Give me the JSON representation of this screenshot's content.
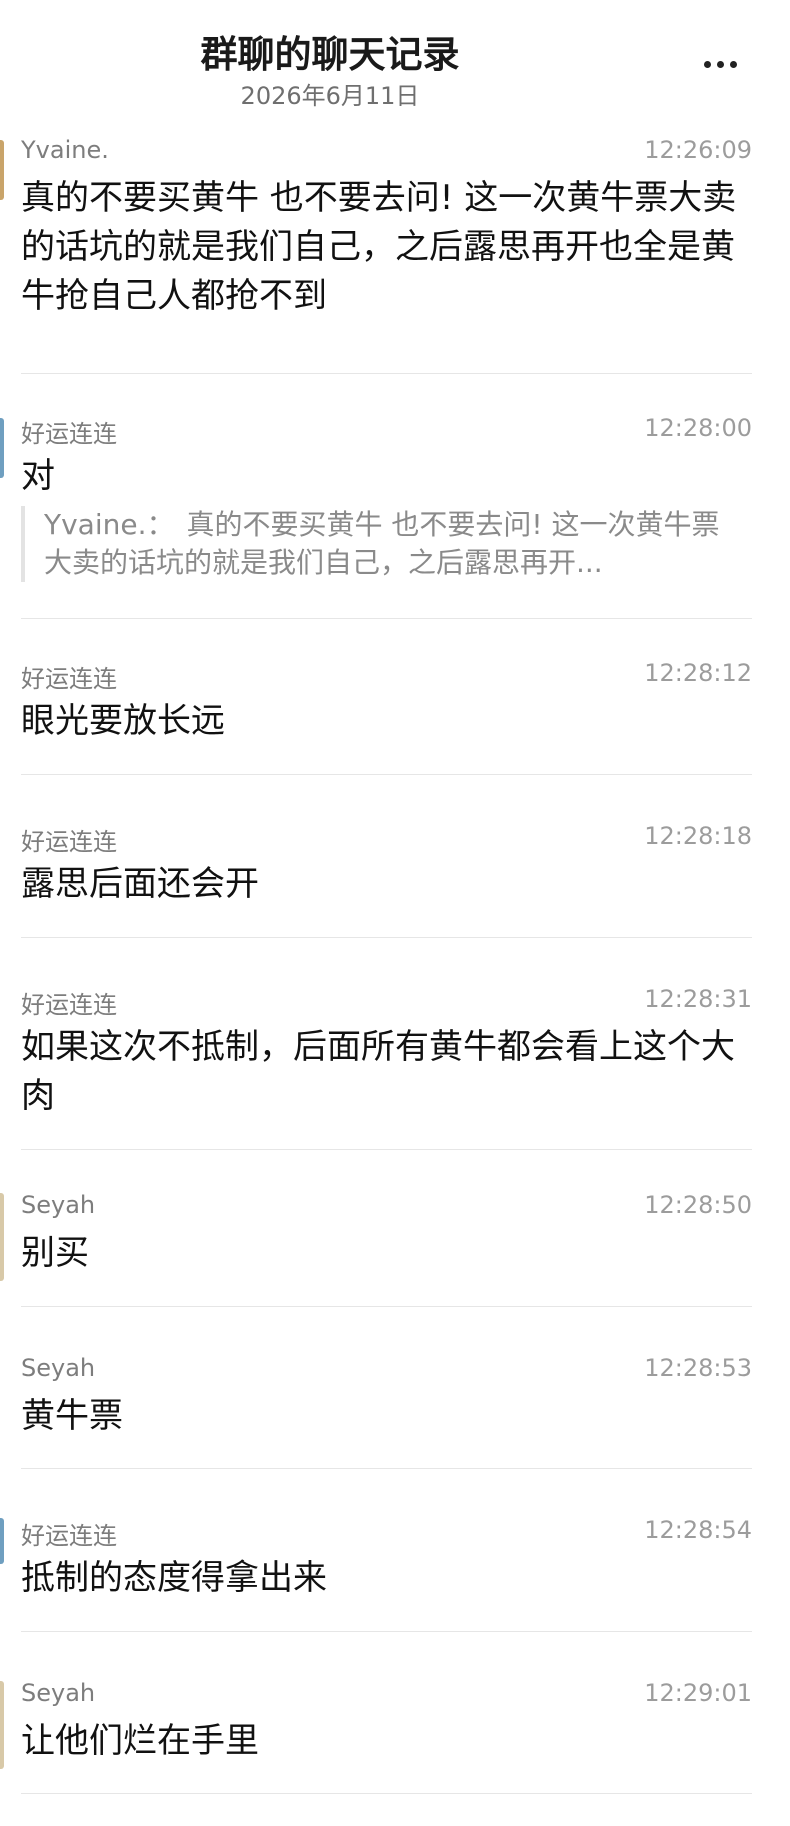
{
  "header": {
    "title": "群聊的聊天记录",
    "date": "2026年6月11日"
  },
  "messages": [
    {
      "sender": "Yvaine.",
      "time": "12:26:09",
      "text": "真的不要买黄牛 也不要去问! 这一次黄牛票大卖的话坑的就是我们自己，之后露思再开也全是黄牛抢自己人都抢不到"
    },
    {
      "sender": "好运连连",
      "time": "12:28:00",
      "text": "对",
      "quote": {
        "sender": "Yvaine.：",
        "text": "真的不要买黄牛 也不要去问! 这一次黄牛票大卖的话坑的就是我们自己，之后露思再开..."
      }
    },
    {
      "sender": "好运连连",
      "time": "12:28:12",
      "text": "眼光要放长远"
    },
    {
      "sender": "好运连连",
      "time": "12:28:18",
      "text": "露思后面还会开"
    },
    {
      "sender": "好运连连",
      "time": "12:28:31",
      "text": "如果这次不抵制，后面所有黄牛都会看上这个大肉"
    },
    {
      "sender": "Seyah",
      "time": "12:28:50",
      "text": "别买"
    },
    {
      "sender": "Seyah",
      "time": "12:28:53",
      "text": "黄牛票"
    },
    {
      "sender": "好运连连",
      "time": "12:28:54",
      "text": "抵制的态度得拿出来"
    },
    {
      "sender": "Seyah",
      "time": "12:29:01",
      "text": "让他们烂在手里"
    }
  ],
  "colors": {
    "avatar_yvaine": "#c9a46a",
    "avatar_haoyun": "#6f9fc0",
    "avatar_seyah": "#d8c9a8"
  }
}
